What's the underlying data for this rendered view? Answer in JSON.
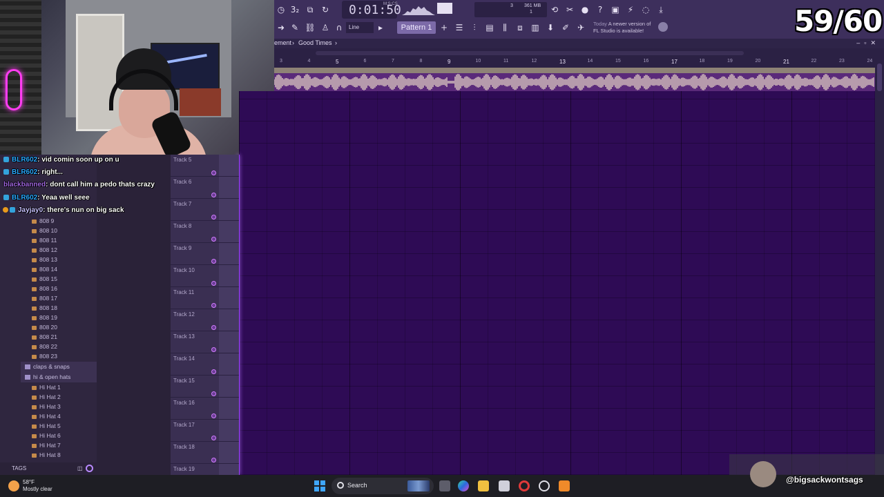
{
  "counter": "59/60",
  "fl": {
    "time": "0:01",
    "time_sec": "50",
    "time_label": "M:S:CS",
    "cpu": "3",
    "ram": "361 MB",
    "cpu_sub": "1",
    "snap_label": "Line",
    "pattern": "Pattern 1",
    "news_today": "Today",
    "news_text_1": "A newer version of",
    "news_text_2": "FL Studio is available!",
    "news_count": "2"
  },
  "playlist": {
    "crumb_parent": "ement",
    "crumb_song": "Good Times",
    "ruler": [
      "3",
      "4",
      "5",
      "6",
      "7",
      "8",
      "9",
      "10",
      "11",
      "12",
      "13",
      "14",
      "15",
      "16",
      "17",
      "18",
      "19",
      "20",
      "21",
      "22",
      "23",
      "24"
    ],
    "ruler_bold": [
      "5",
      "9",
      "13",
      "17",
      "21"
    ],
    "tracks": [
      "Track 5",
      "Track 6",
      "Track 7",
      "Track 8",
      "Track 9",
      "Track 10",
      "Track 11",
      "Track 12",
      "Track 13",
      "Track 14",
      "Track 15",
      "Track 16",
      "Track 17",
      "Track 18",
      "Track 19"
    ]
  },
  "browser": {
    "items_808": [
      "808 9",
      "808 10",
      "808 11",
      "808 12",
      "808 13",
      "808 14",
      "808 15",
      "808 16",
      "808 17",
      "808 18",
      "808 19",
      "808 20",
      "808 21",
      "808 22",
      "808 23"
    ],
    "folder_claps": "claps & snaps",
    "folder_hats": "hi & open hats",
    "items_hats": [
      "Hi Hat 1",
      "Hi Hat 2",
      "Hi Hat 3",
      "Hi Hat 4",
      "Hi Hat 5",
      "Hi Hat 6",
      "Hi Hat 7",
      "Hi Hat 8"
    ],
    "tags_label": "TAGS"
  },
  "chat": [
    {
      "user": "BLR602",
      "msg": ": vid comin soon up on u"
    },
    {
      "user": "BLR602",
      "msg": ": right..."
    },
    {
      "user": "blackbanned",
      "msg": ": dont call him a pedo thats crazy"
    },
    {
      "user": "BLR602",
      "msg": ": Yeaa well seee"
    },
    {
      "user": "Jayjay0",
      "msg": ": there's nun on big sack"
    }
  ],
  "taskbar": {
    "temp": "58°F",
    "weather": "Mostly clear",
    "search": "Search"
  },
  "handle": "@bigsackwontsags"
}
